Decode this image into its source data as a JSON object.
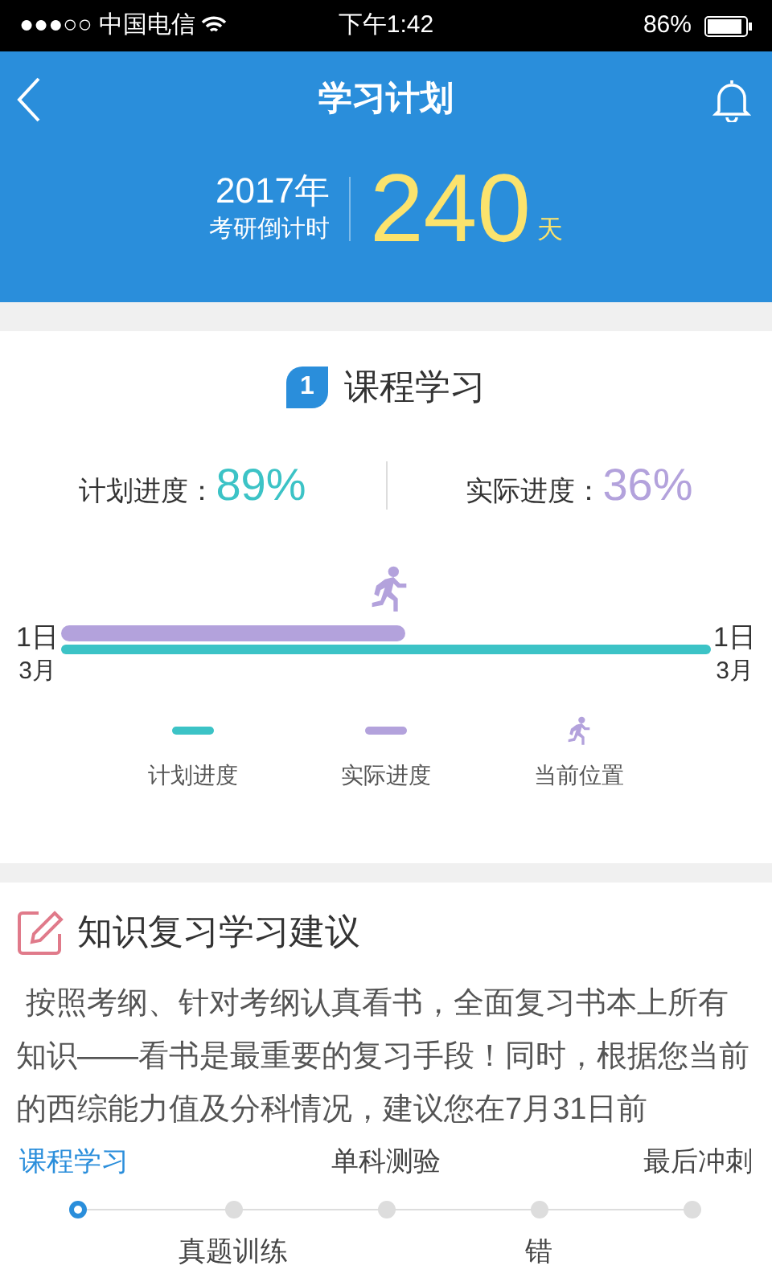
{
  "status_bar": {
    "carrier": "●●●○○ 中国电信",
    "time": "下午1:42",
    "battery": "86%"
  },
  "header": {
    "title": "学习计划",
    "year": "2017年",
    "countdown_label": "考研倒计时",
    "days": "240",
    "days_unit": "天"
  },
  "course": {
    "badge": "1",
    "title": "课程学习",
    "planned_label": "计划进度：",
    "planned_value": "89%",
    "actual_label": "实际进度：",
    "actual_value": "36%",
    "start_day": "1日",
    "start_month": "3月",
    "end_day": "1日",
    "end_month": "3月",
    "legend": [
      {
        "kind": "line",
        "label": "计划进度",
        "color": "#3cc3c6"
      },
      {
        "kind": "line",
        "label": "实际进度",
        "color": "#b3a2dc"
      },
      {
        "kind": "runner",
        "label": "当前位置",
        "color": "#b3a2dc"
      }
    ]
  },
  "advice": {
    "title": "知识复习学习建议",
    "text": "按照考纲、针对考纲认真看书，全面复习书本上所有知识——看书是最重要的复习手段！同时，根据您当前的西综能力值及分科情况，建议您在7月31日前"
  },
  "stepper": [
    {
      "label": "课程学习",
      "selected": true
    },
    {
      "label": "真题训练",
      "selected": false
    },
    {
      "label": "单科测验",
      "selected": false
    },
    {
      "label": "错",
      "selected": false
    },
    {
      "label": "最后冲刺",
      "selected": false
    }
  ]
}
